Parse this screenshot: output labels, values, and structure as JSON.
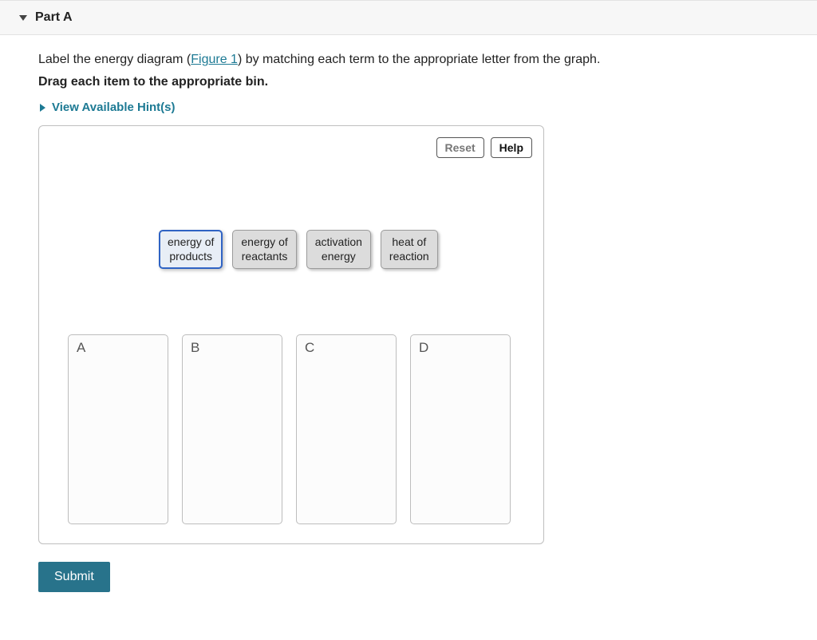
{
  "part_header": "Part A",
  "question": {
    "pre": "Label the energy diagram (",
    "figure_text": "Figure 1",
    "post": ") by matching each term to the appropriate letter from the graph."
  },
  "instruction": "Drag each item to the appropriate bin.",
  "hints_label": "View Available Hint(s)",
  "buttons": {
    "reset": "Reset",
    "help": "Help",
    "submit": "Submit"
  },
  "drag_items": [
    {
      "line1": "energy of",
      "line2": "products",
      "selected": true
    },
    {
      "line1": "energy of",
      "line2": "reactants",
      "selected": false
    },
    {
      "line1": "activation",
      "line2": "energy",
      "selected": false
    },
    {
      "line1": "heat of",
      "line2": "reaction",
      "selected": false
    }
  ],
  "bins": [
    "A",
    "B",
    "C",
    "D"
  ]
}
